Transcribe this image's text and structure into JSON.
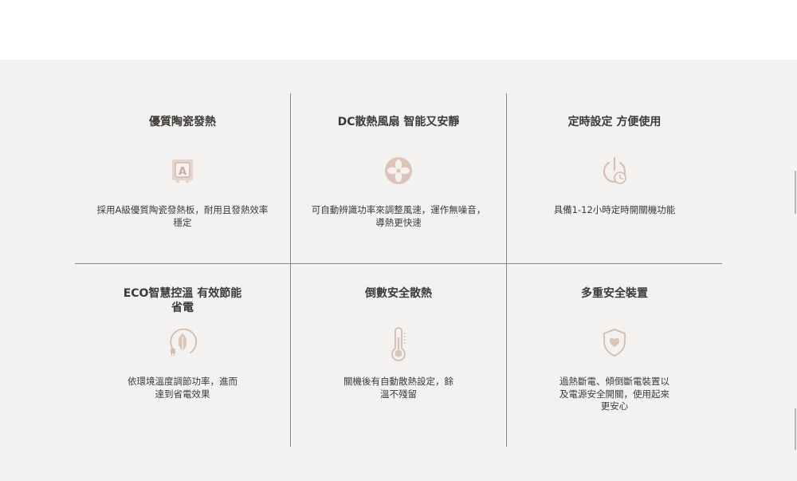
{
  "colors": {
    "panel_bg": "#f3f2f1",
    "icon_tan": "#d9c2b5",
    "text": "#3d3a38",
    "divider": "#8a8785"
  },
  "features": [
    {
      "title": "優質陶瓷發熱",
      "icon": "ceramic-plate-icon",
      "desc_lines": [
        "採用A級優質陶瓷發熱板，耐用且發熱效率",
        "穩定"
      ]
    },
    {
      "title": "DC散熱風扇 智能又安靜",
      "icon": "fan-icon",
      "desc_lines": [
        "可自動辨識功率來調整風速，運作無噪音，",
        "導熱更快速"
      ]
    },
    {
      "title": "定時設定 方便使用",
      "icon": "power-timer-icon",
      "desc_lines": [
        "具備1-12小時定時開關機功能"
      ]
    },
    {
      "title_lines": [
        "ECO智慧控溫 有效節能",
        "省電"
      ],
      "icon": "eco-leaf-plug-icon",
      "desc_lines": [
        "依環境溫度調節功率，進而",
        "達到省電效果"
      ]
    },
    {
      "title": "倒數安全散熱",
      "icon": "thermometer-icon",
      "desc_lines": [
        "關機後有自動散熱設定，餘",
        "溫不殘留"
      ]
    },
    {
      "title": "多重安全裝置",
      "icon": "shield-heart-icon",
      "desc_lines": [
        "過熱斷電、傾倒斷電裝置以",
        "及電源安全開關，使用起來",
        "更安心"
      ]
    }
  ]
}
